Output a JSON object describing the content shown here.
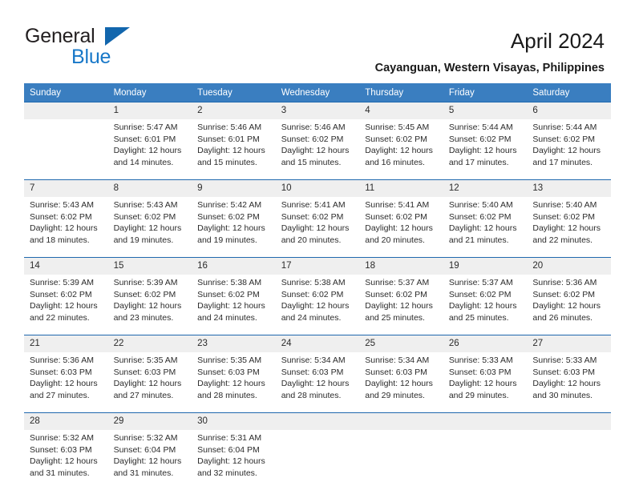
{
  "brand": {
    "name_part1": "General",
    "name_part2": "Blue",
    "logo_icon": "triangle-flag-icon"
  },
  "header": {
    "title": "April 2024",
    "location": "Cayanguan, Western Visayas, Philippines"
  },
  "weekdays": [
    "Sunday",
    "Monday",
    "Tuesday",
    "Wednesday",
    "Thursday",
    "Friday",
    "Saturday"
  ],
  "colors": {
    "header_band": "#3a7ec0",
    "row_rule": "#1f68ae",
    "daynum_band": "#efefef",
    "brand_blue": "#1878c8",
    "logo_blue": "#1266ad",
    "text": "#2b2b2b"
  },
  "weeks": [
    {
      "days": [
        {
          "num": "",
          "lines": []
        },
        {
          "num": "1",
          "lines": [
            "Sunrise: 5:47 AM",
            "Sunset: 6:01 PM",
            "Daylight: 12 hours",
            "and 14 minutes."
          ]
        },
        {
          "num": "2",
          "lines": [
            "Sunrise: 5:46 AM",
            "Sunset: 6:01 PM",
            "Daylight: 12 hours",
            "and 15 minutes."
          ]
        },
        {
          "num": "3",
          "lines": [
            "Sunrise: 5:46 AM",
            "Sunset: 6:02 PM",
            "Daylight: 12 hours",
            "and 15 minutes."
          ]
        },
        {
          "num": "4",
          "lines": [
            "Sunrise: 5:45 AM",
            "Sunset: 6:02 PM",
            "Daylight: 12 hours",
            "and 16 minutes."
          ]
        },
        {
          "num": "5",
          "lines": [
            "Sunrise: 5:44 AM",
            "Sunset: 6:02 PM",
            "Daylight: 12 hours",
            "and 17 minutes."
          ]
        },
        {
          "num": "6",
          "lines": [
            "Sunrise: 5:44 AM",
            "Sunset: 6:02 PM",
            "Daylight: 12 hours",
            "and 17 minutes."
          ]
        }
      ]
    },
    {
      "days": [
        {
          "num": "7",
          "lines": [
            "Sunrise: 5:43 AM",
            "Sunset: 6:02 PM",
            "Daylight: 12 hours",
            "and 18 minutes."
          ]
        },
        {
          "num": "8",
          "lines": [
            "Sunrise: 5:43 AM",
            "Sunset: 6:02 PM",
            "Daylight: 12 hours",
            "and 19 minutes."
          ]
        },
        {
          "num": "9",
          "lines": [
            "Sunrise: 5:42 AM",
            "Sunset: 6:02 PM",
            "Daylight: 12 hours",
            "and 19 minutes."
          ]
        },
        {
          "num": "10",
          "lines": [
            "Sunrise: 5:41 AM",
            "Sunset: 6:02 PM",
            "Daylight: 12 hours",
            "and 20 minutes."
          ]
        },
        {
          "num": "11",
          "lines": [
            "Sunrise: 5:41 AM",
            "Sunset: 6:02 PM",
            "Daylight: 12 hours",
            "and 20 minutes."
          ]
        },
        {
          "num": "12",
          "lines": [
            "Sunrise: 5:40 AM",
            "Sunset: 6:02 PM",
            "Daylight: 12 hours",
            "and 21 minutes."
          ]
        },
        {
          "num": "13",
          "lines": [
            "Sunrise: 5:40 AM",
            "Sunset: 6:02 PM",
            "Daylight: 12 hours",
            "and 22 minutes."
          ]
        }
      ]
    },
    {
      "days": [
        {
          "num": "14",
          "lines": [
            "Sunrise: 5:39 AM",
            "Sunset: 6:02 PM",
            "Daylight: 12 hours",
            "and 22 minutes."
          ]
        },
        {
          "num": "15",
          "lines": [
            "Sunrise: 5:39 AM",
            "Sunset: 6:02 PM",
            "Daylight: 12 hours",
            "and 23 minutes."
          ]
        },
        {
          "num": "16",
          "lines": [
            "Sunrise: 5:38 AM",
            "Sunset: 6:02 PM",
            "Daylight: 12 hours",
            "and 24 minutes."
          ]
        },
        {
          "num": "17",
          "lines": [
            "Sunrise: 5:38 AM",
            "Sunset: 6:02 PM",
            "Daylight: 12 hours",
            "and 24 minutes."
          ]
        },
        {
          "num": "18",
          "lines": [
            "Sunrise: 5:37 AM",
            "Sunset: 6:02 PM",
            "Daylight: 12 hours",
            "and 25 minutes."
          ]
        },
        {
          "num": "19",
          "lines": [
            "Sunrise: 5:37 AM",
            "Sunset: 6:02 PM",
            "Daylight: 12 hours",
            "and 25 minutes."
          ]
        },
        {
          "num": "20",
          "lines": [
            "Sunrise: 5:36 AM",
            "Sunset: 6:02 PM",
            "Daylight: 12 hours",
            "and 26 minutes."
          ]
        }
      ]
    },
    {
      "days": [
        {
          "num": "21",
          "lines": [
            "Sunrise: 5:36 AM",
            "Sunset: 6:03 PM",
            "Daylight: 12 hours",
            "and 27 minutes."
          ]
        },
        {
          "num": "22",
          "lines": [
            "Sunrise: 5:35 AM",
            "Sunset: 6:03 PM",
            "Daylight: 12 hours",
            "and 27 minutes."
          ]
        },
        {
          "num": "23",
          "lines": [
            "Sunrise: 5:35 AM",
            "Sunset: 6:03 PM",
            "Daylight: 12 hours",
            "and 28 minutes."
          ]
        },
        {
          "num": "24",
          "lines": [
            "Sunrise: 5:34 AM",
            "Sunset: 6:03 PM",
            "Daylight: 12 hours",
            "and 28 minutes."
          ]
        },
        {
          "num": "25",
          "lines": [
            "Sunrise: 5:34 AM",
            "Sunset: 6:03 PM",
            "Daylight: 12 hours",
            "and 29 minutes."
          ]
        },
        {
          "num": "26",
          "lines": [
            "Sunrise: 5:33 AM",
            "Sunset: 6:03 PM",
            "Daylight: 12 hours",
            "and 29 minutes."
          ]
        },
        {
          "num": "27",
          "lines": [
            "Sunrise: 5:33 AM",
            "Sunset: 6:03 PM",
            "Daylight: 12 hours",
            "and 30 minutes."
          ]
        }
      ]
    },
    {
      "days": [
        {
          "num": "28",
          "lines": [
            "Sunrise: 5:32 AM",
            "Sunset: 6:03 PM",
            "Daylight: 12 hours",
            "and 31 minutes."
          ]
        },
        {
          "num": "29",
          "lines": [
            "Sunrise: 5:32 AM",
            "Sunset: 6:04 PM",
            "Daylight: 12 hours",
            "and 31 minutes."
          ]
        },
        {
          "num": "30",
          "lines": [
            "Sunrise: 5:31 AM",
            "Sunset: 6:04 PM",
            "Daylight: 12 hours",
            "and 32 minutes."
          ]
        },
        {
          "num": "",
          "lines": []
        },
        {
          "num": "",
          "lines": []
        },
        {
          "num": "",
          "lines": []
        },
        {
          "num": "",
          "lines": []
        }
      ]
    }
  ]
}
